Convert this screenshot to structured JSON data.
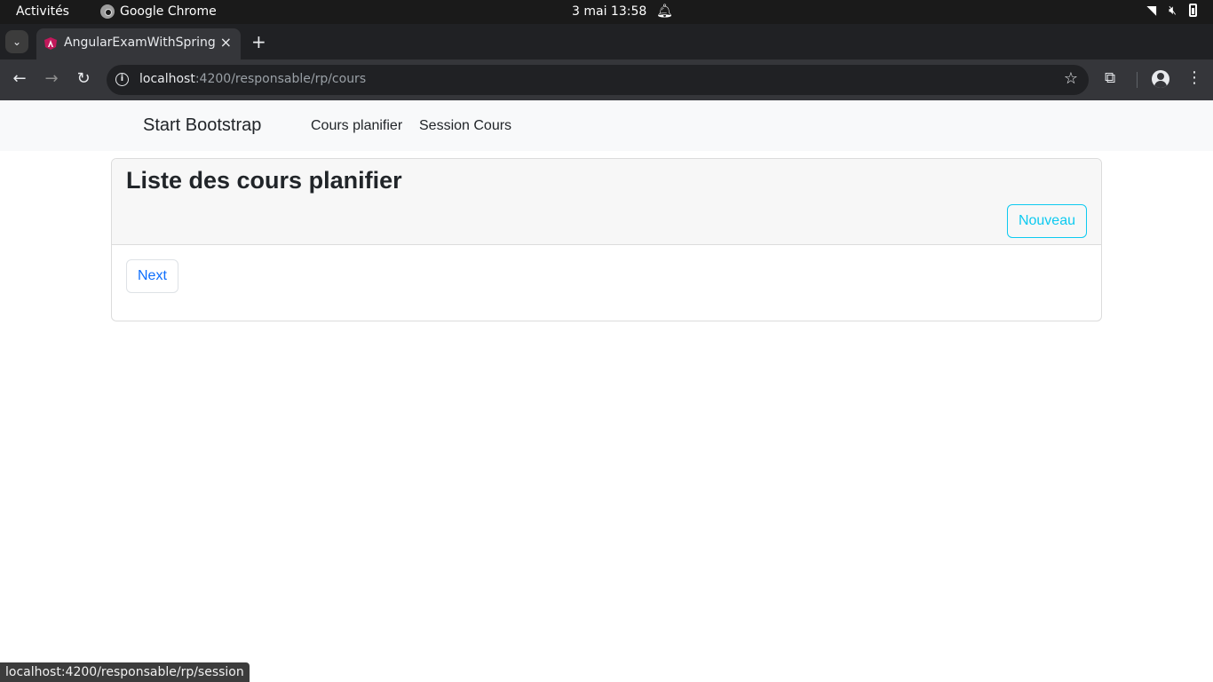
{
  "os": {
    "activities": "Activités",
    "app_name": "Google Chrome",
    "clock": "3 mai  13:58"
  },
  "browser": {
    "tab_title": "AngularExamWithSpring",
    "url_host": "localhost",
    "url_path": ":4200/responsable/rp/cours",
    "status_url": "localhost:4200/responsable/rp/session"
  },
  "navbar": {
    "brand": "Start Bootstrap",
    "links": [
      "Cours planifier",
      "Session Cours"
    ]
  },
  "card": {
    "title": "Liste des cours planifier",
    "new_button": "Nouveau",
    "next_button": "Next"
  },
  "colors": {
    "info": "#0dcaf0",
    "primary": "#0d6efd"
  }
}
